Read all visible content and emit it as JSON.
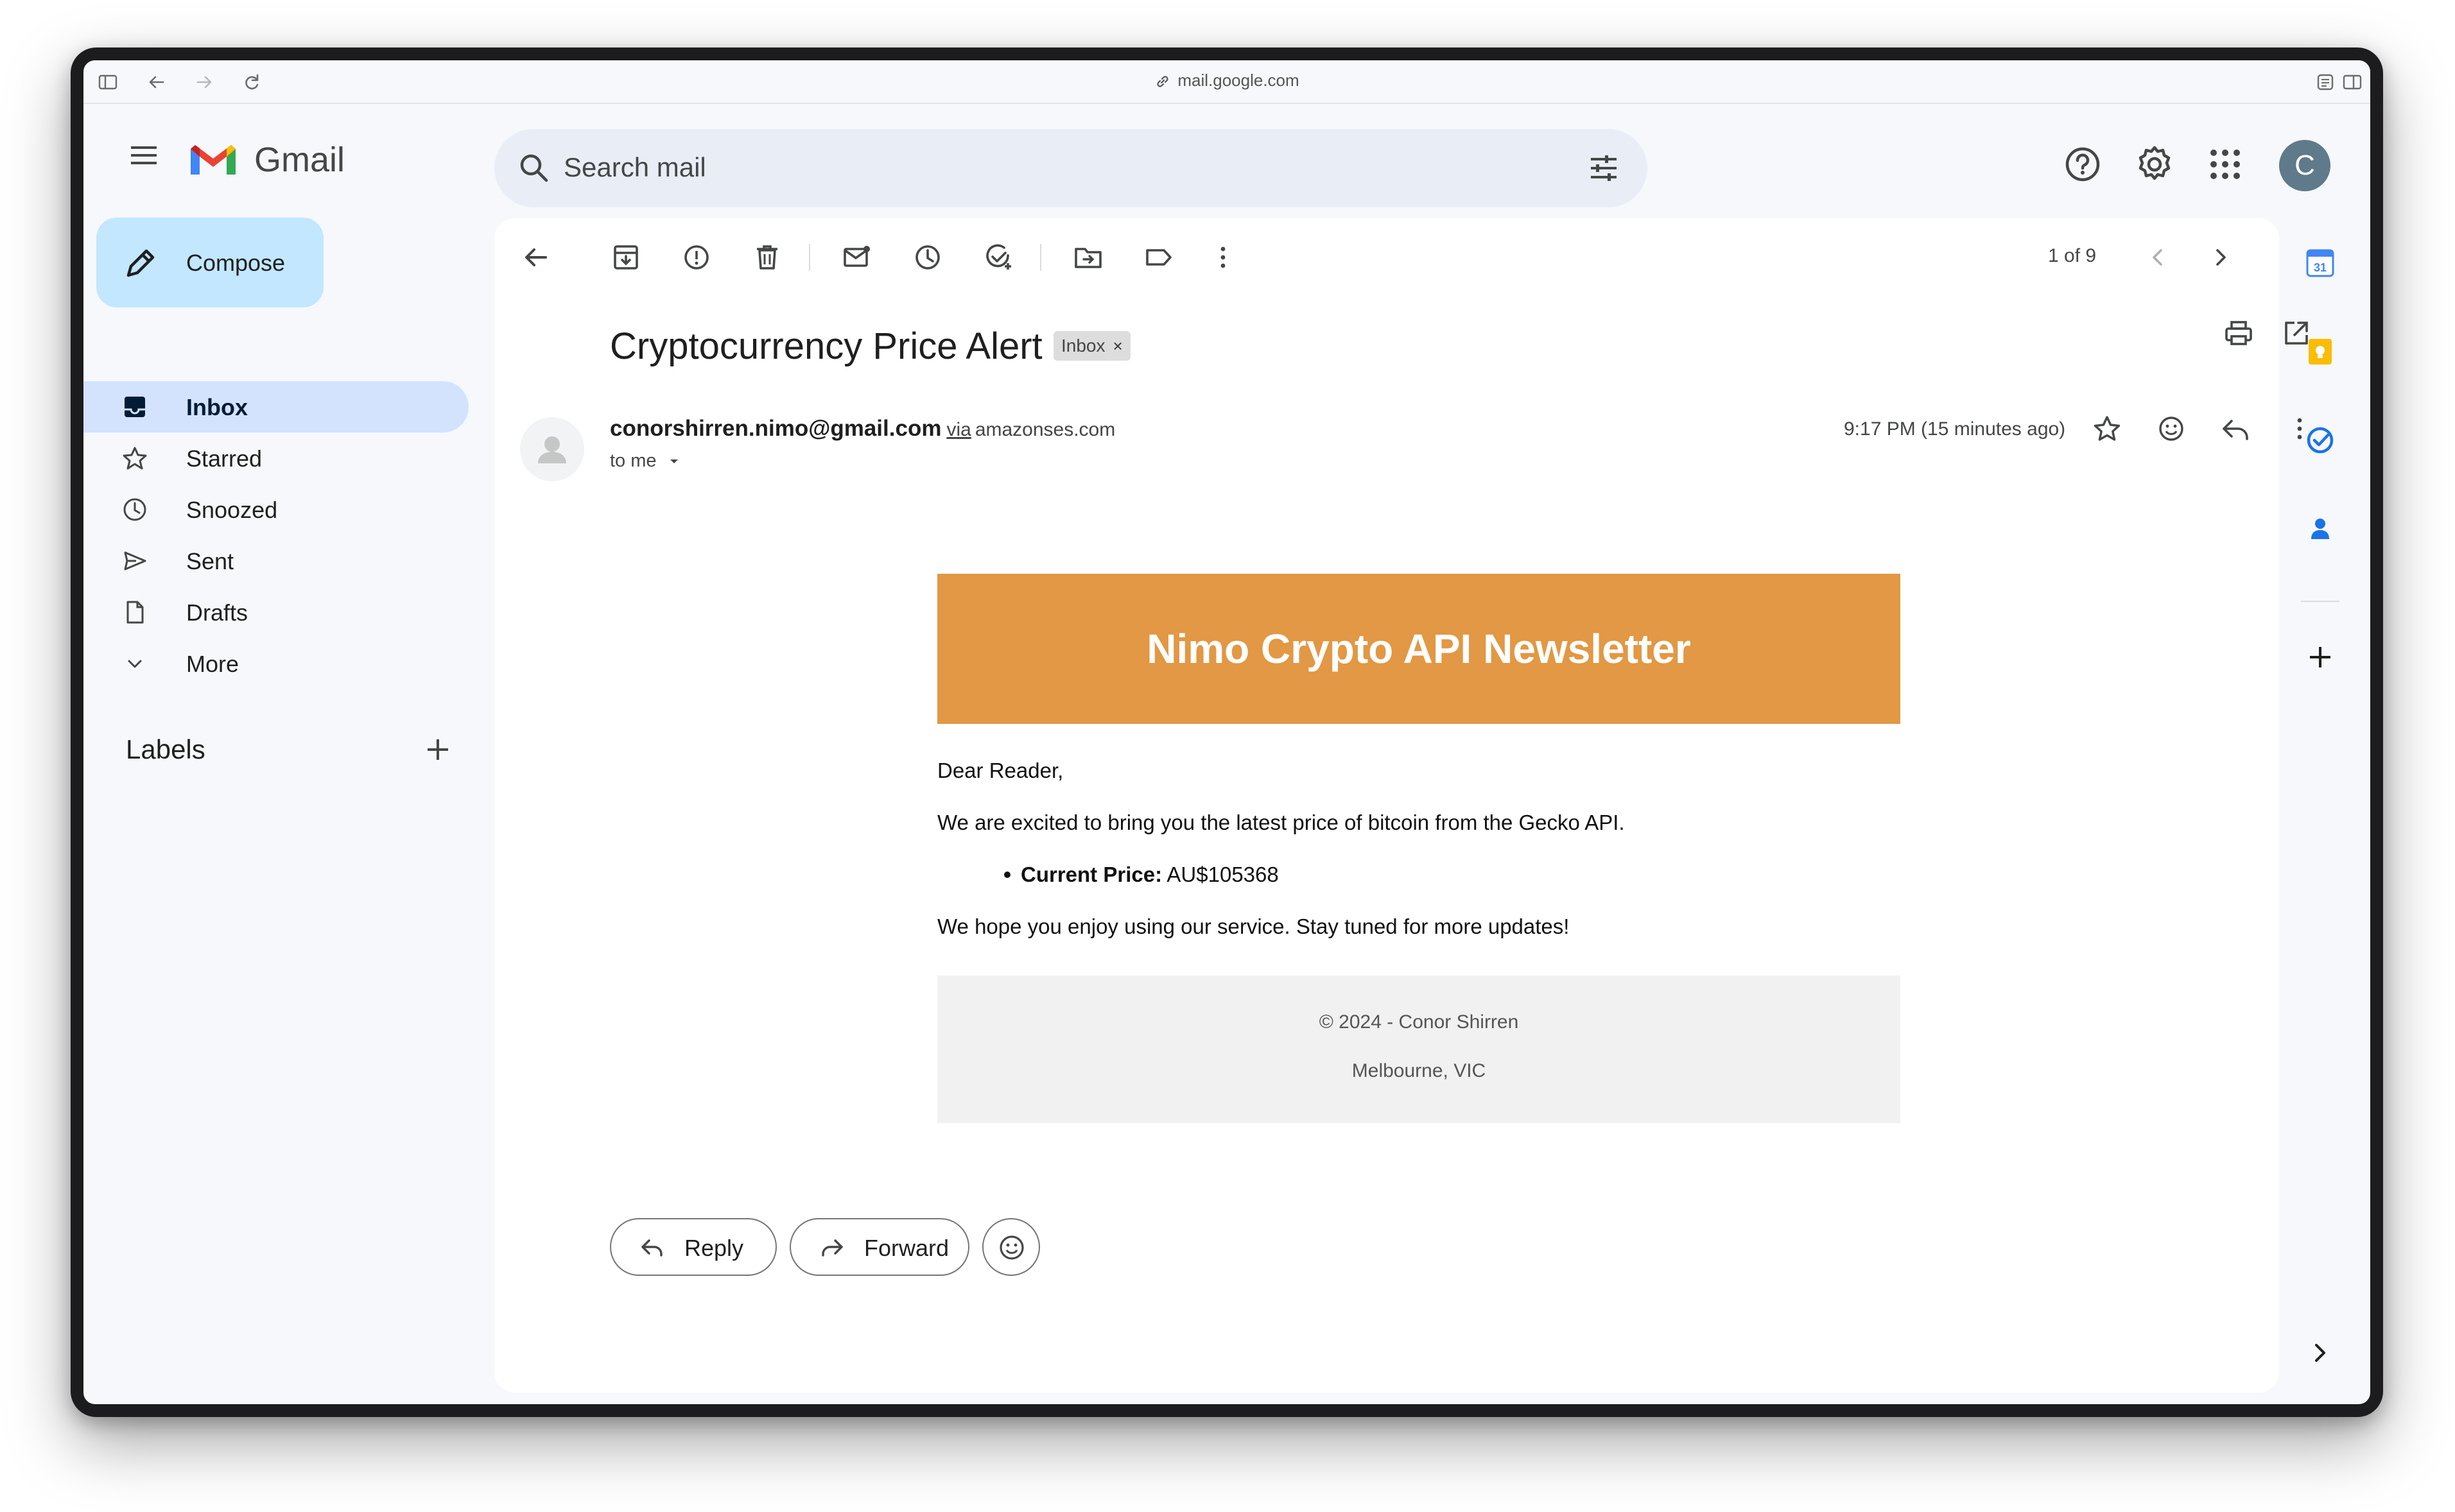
{
  "browser": {
    "url": "mail.google.com"
  },
  "app": {
    "name": "Gmail",
    "avatar_letter": "C"
  },
  "search": {
    "placeholder": "Search mail"
  },
  "sidebar": {
    "compose_label": "Compose",
    "items": [
      {
        "label": "Inbox",
        "active": true,
        "icon": "inbox-icon"
      },
      {
        "label": "Starred",
        "icon": "star-icon"
      },
      {
        "label": "Snoozed",
        "icon": "clock-icon"
      },
      {
        "label": "Sent",
        "icon": "send-icon"
      },
      {
        "label": "Drafts",
        "icon": "draft-icon"
      },
      {
        "label": "More",
        "icon": "chevron-down-icon"
      }
    ],
    "labels_header": "Labels"
  },
  "toolbar": {
    "pager": "1 of 9"
  },
  "message": {
    "subject": "Cryptocurrency Price Alert",
    "chip": "Inbox",
    "chip_close": "×",
    "sender_email": "conorshirren.nimo@gmail.com",
    "via": "via",
    "via_domain": "amazonses.com",
    "to": "to me",
    "time": "9:17 PM (15 minutes ago)"
  },
  "email_body": {
    "banner": "Nimo Crypto API Newsletter",
    "greeting": "Dear Reader,",
    "intro": "We are excited to bring you the latest price of bitcoin from the Gecko API.",
    "price_label": "Current Price:",
    "price_value": "AU$105368",
    "outro": "We hope you enjoy using our service. Stay tuned for more updates!",
    "footer_line1": "© 2024 - Conor Shirren",
    "footer_line2": "Melbourne, VIC"
  },
  "actions": {
    "reply": "Reply",
    "forward": "Forward"
  },
  "colors": {
    "banner": "#e29844",
    "compose": "#c2e7ff",
    "active_nav": "#d3e3fd"
  }
}
